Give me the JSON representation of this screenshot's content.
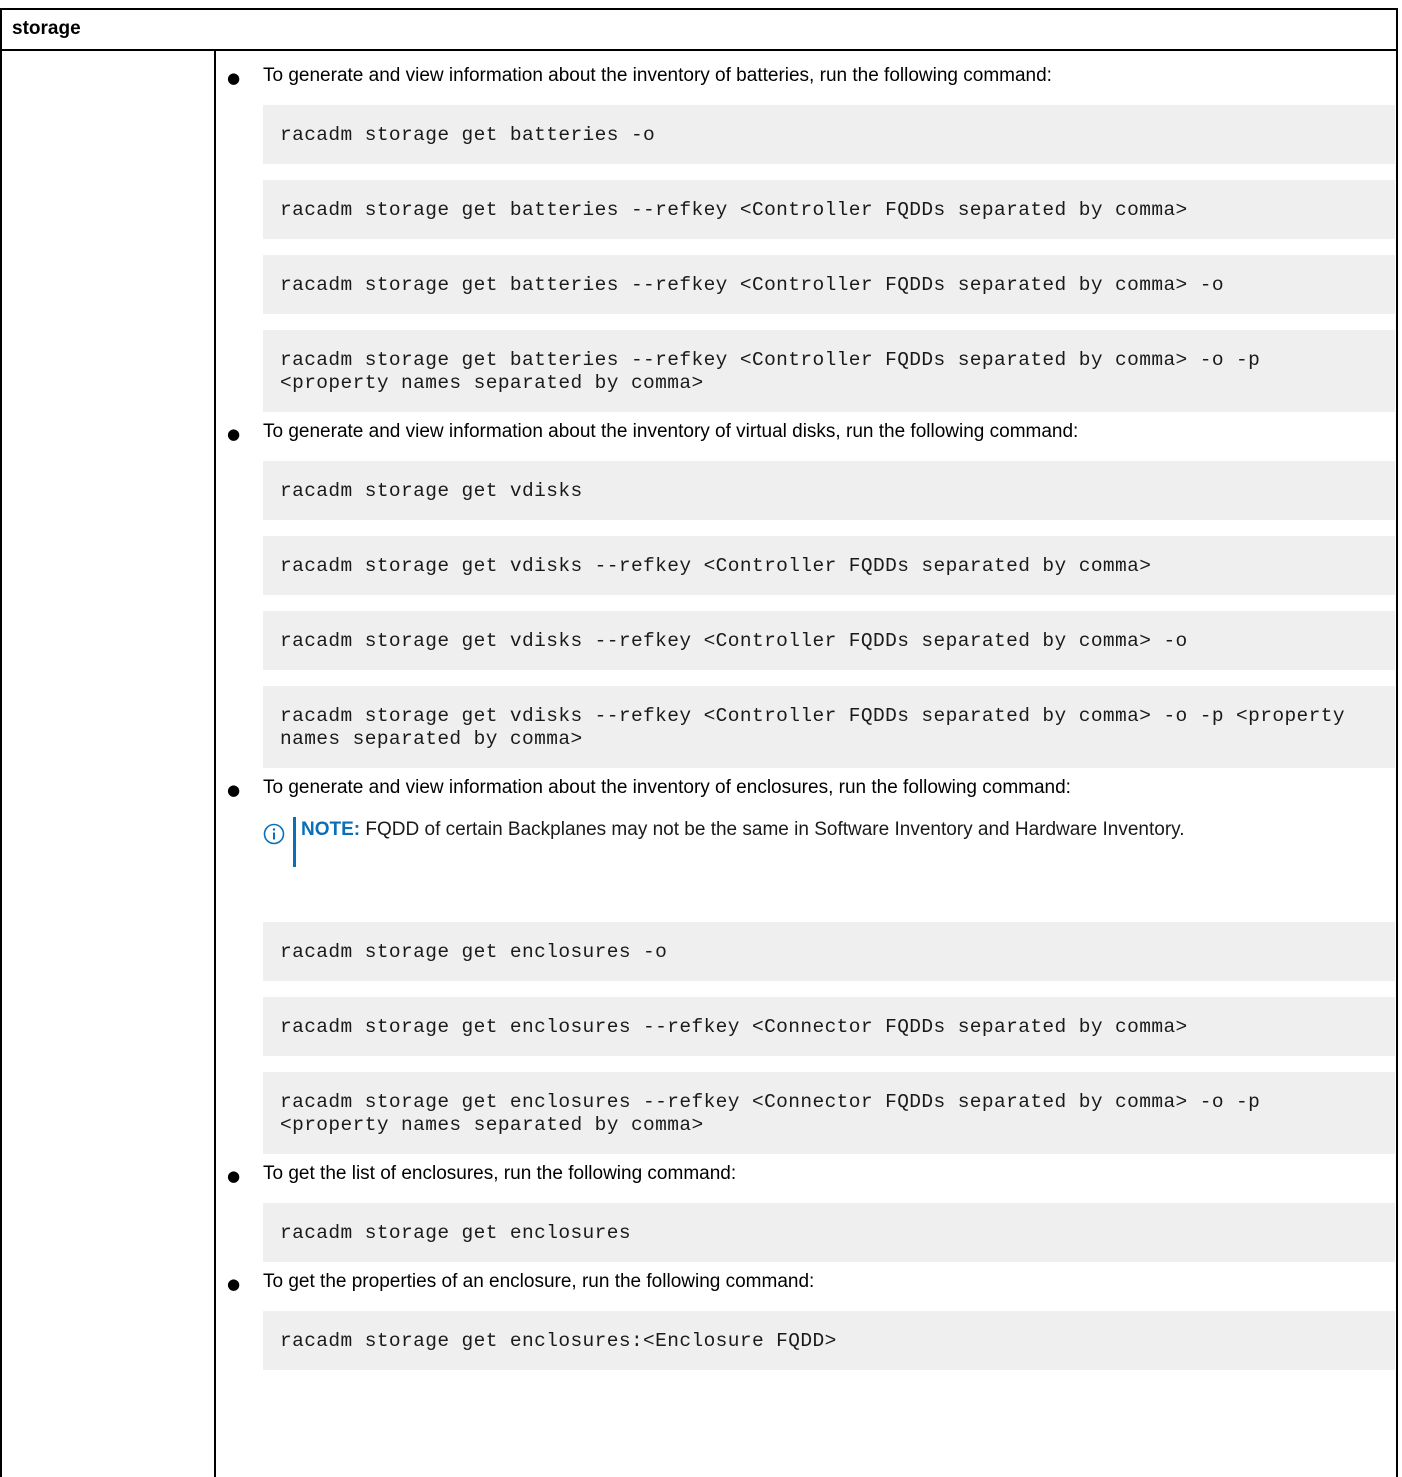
{
  "section": {
    "title": "storage"
  },
  "items": [
    {
      "text": "To generate and view information about the inventory of batteries, run the following command:",
      "commands": [
        "racadm storage get batteries -o",
        "racadm storage get batteries --refkey <Controller FQDDs separated by comma>",
        "racadm storage get batteries --refkey <Controller FQDDs separated by comma> -o",
        "racadm storage get batteries --refkey <Controller FQDDs separated by comma> -o -p <property names separated by comma>"
      ]
    },
    {
      "text": "To generate and view information about the inventory of virtual disks, run the following command:",
      "commands": [
        "racadm storage get vdisks",
        "racadm storage get vdisks --refkey <Controller FQDDs separated by comma>",
        "racadm storage get vdisks --refkey <Controller FQDDs separated by comma> -o",
        "racadm storage get vdisks --refkey <Controller FQDDs separated by comma> -o -p <property names separated by comma>"
      ]
    },
    {
      "text": "To generate and view information about the inventory of enclosures, run the following command:",
      "note": {
        "label": "NOTE:",
        "text": "FQDD of certain Backplanes may not be the same in Software Inventory and Hardware Inventory.",
        "icon": "info-icon",
        "accent": "#0b6fb8"
      },
      "commands": [
        "racadm storage get enclosures -o",
        "racadm storage get enclosures --refkey <Connector FQDDs separated by comma>",
        "racadm storage get enclosures --refkey <Connector FQDDs separated by comma> -o -p <property names separated by comma>"
      ]
    },
    {
      "text": "To get the list of enclosures, run the following command:",
      "commands": [
        "racadm storage get enclosures"
      ]
    },
    {
      "text": "To get the properties of an enclosure, run the following command:",
      "commands": [
        "racadm storage get enclosures:<Enclosure FQDD>"
      ]
    }
  ]
}
